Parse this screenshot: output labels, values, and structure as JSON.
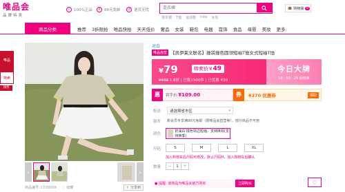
{
  "header": {
    "logo_main": "唯品会",
    "logo_sub": "品牌特卖",
    "promises": [
      {
        "icon": "check-icon",
        "label": "100%正品"
      },
      {
        "icon": "yuan-icon",
        "label": "88元免邮"
      },
      {
        "icon": "return-icon",
        "label": "退货无忧"
      }
    ],
    "search_placeholder": "连衣裙",
    "hot_words": [
      "连衣裙",
      "T恤",
      "运动鞋",
      "nike",
      "女包"
    ],
    "cart_label": "购物袋",
    "cart_count": "0"
  },
  "nav": {
    "category_button": "商品分类",
    "items": [
      "推荐",
      "3折限抢",
      "唯品快抢",
      "天天低价",
      "奢品",
      "女装",
      "鞋包",
      "电器",
      "首饰",
      "食品",
      "母婴",
      "美妆",
      "更多"
    ]
  },
  "side_ad": {
    "top": "唯品",
    "mid": "特卖",
    "bottom": "领券"
  },
  "gallery": {
    "product_code": "商品编号: C07000X",
    "favorite_label": "收藏",
    "share_label": "分享到"
  },
  "product": {
    "brand": "对白",
    "title_tag": "唯品自营",
    "title": "【凯伊莱文联名】撞袋撞色圆领短袖T恤女式短袖T恤",
    "price": "79",
    "special_label": "特卖价",
    "special_price": "49",
    "original_price": "¥449",
    "discount_info": "1.8折 | 已售1500件 | 已优惠 ¥30",
    "today_title": "今日大牌",
    "timer": "18 : 59 : 29  后结束"
  },
  "coupons": {
    "left_icon": "惠",
    "left_desc": "到手价",
    "left_price": "¥109.00",
    "right_icon": "券",
    "right_text": "¥370 优惠券",
    "right_button": "领取"
  },
  "options": {
    "ship_label": "配送",
    "ship_value": "请选择省市区",
    "service_label": "服务",
    "service_text": "新会员专享满88元免邮（限唯品会直营等），部分商品不可用",
    "color_label": "颜色",
    "color_value": "奶油白  撞色领边短袖，支持换领(支持换季)",
    "size_label": "尺码",
    "sizes": [
      "S",
      "M",
      "L",
      "XL"
    ],
    "size_hint": "加入购物车后尺码可修改，默认尺码M，加入购物车后确认",
    "qty_label": "数量",
    "qty_minus": "−",
    "qty_value": "1",
    "qty_plus": "+"
  },
  "footer": {
    "notice": "● 提醒: 该商品为唯品会官方购买",
    "buy_button": "立即购买",
    "fav_icon": "heart-icon"
  }
}
